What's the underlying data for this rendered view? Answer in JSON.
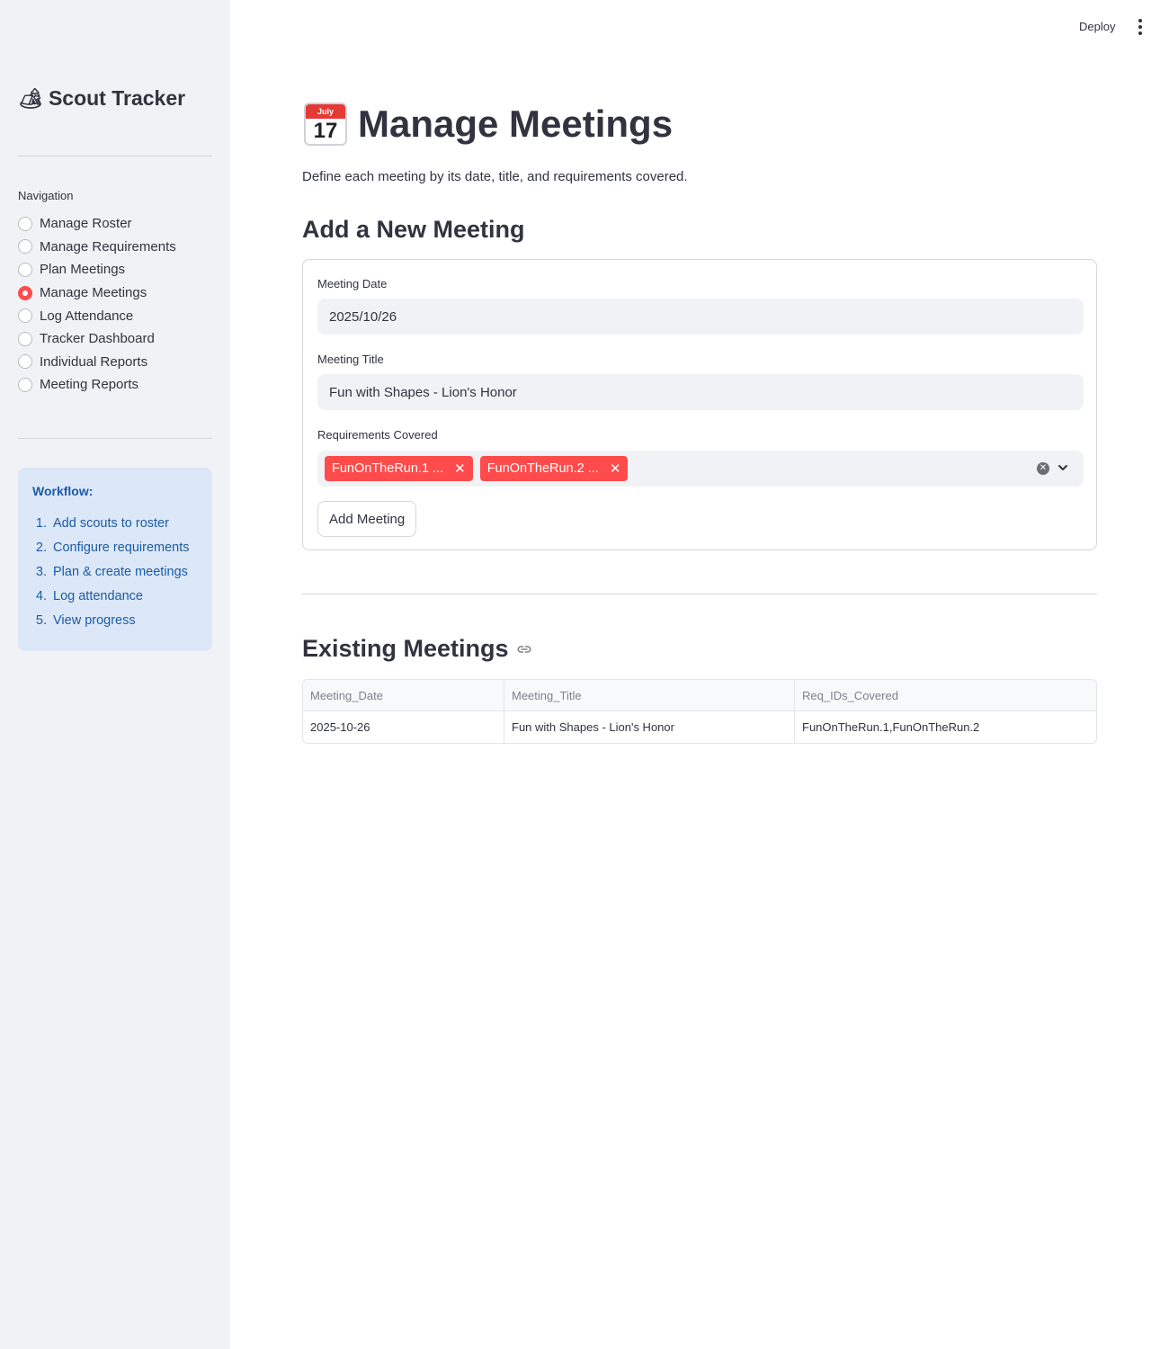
{
  "header": {
    "deploy_label": "Deploy",
    "menu_icon": "kebab-menu-icon"
  },
  "sidebar": {
    "app_icon": "tent-icon",
    "app_title": "Scout Tracker",
    "nav_label": "Navigation",
    "nav_items": [
      {
        "label": "Manage Roster",
        "selected": false
      },
      {
        "label": "Manage Requirements",
        "selected": false
      },
      {
        "label": "Plan Meetings",
        "selected": false
      },
      {
        "label": "Manage Meetings",
        "selected": true
      },
      {
        "label": "Log Attendance",
        "selected": false
      },
      {
        "label": "Tracker Dashboard",
        "selected": false
      },
      {
        "label": "Individual Reports",
        "selected": false
      },
      {
        "label": "Meeting Reports",
        "selected": false
      }
    ],
    "workflow": {
      "title": "Workflow:",
      "steps": [
        {
          "num": "1.",
          "text": "Add scouts to roster"
        },
        {
          "num": "2.",
          "text": "Configure requirements"
        },
        {
          "num": "3.",
          "text": "Plan & create meetings"
        },
        {
          "num": "4.",
          "text": "Log attendance"
        },
        {
          "num": "5.",
          "text": "View progress"
        }
      ]
    },
    "accent_color": "#ff4b4b"
  },
  "main": {
    "title_icon": "calendar-icon",
    "calendar_icon_month": "July",
    "calendar_icon_day": "17",
    "title": "Manage Meetings",
    "subtitle": "Define each meeting by its date, title, and requirements covered.",
    "add_section_title": "Add a New Meeting",
    "form": {
      "date_label": "Meeting Date",
      "date_value": "2025/10/26",
      "title_label": "Meeting Title",
      "title_value": "Fun with Shapes - Lion's Honor",
      "req_label": "Requirements Covered",
      "req_chips": [
        "FunOnTheRun.1 ...",
        "FunOnTheRun.2 ..."
      ],
      "submit_label": "Add Meeting"
    },
    "existing_section_title": "Existing Meetings",
    "table": {
      "columns": [
        "Meeting_Date",
        "Meeting_Title",
        "Req_IDs_Covered"
      ],
      "rows": [
        [
          "2025-10-26",
          "Fun with Shapes - Lion's Honor",
          "FunOnTheRun.1,FunOnTheRun.2"
        ]
      ]
    }
  }
}
